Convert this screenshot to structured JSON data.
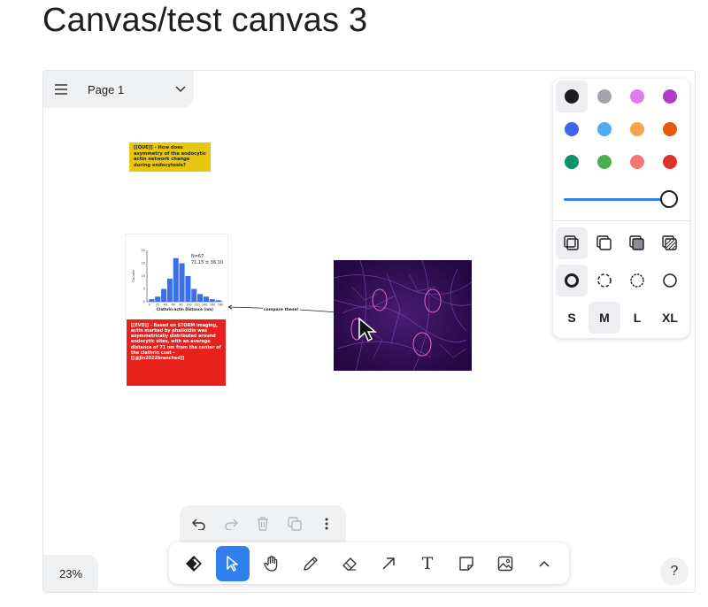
{
  "page_title": "Canvas/test canvas 3",
  "page_menu": {
    "name": "Page 1"
  },
  "notes": {
    "question": "[[QUE]] - How does asymmetry of the endocytic actin network change during endocytosis?",
    "evidence": "[[EVD]] - Based on STORM imaging, actin marked by phalloidin was asymmetrically distributed around endocytic sites, with an average distance of 71 nm from the center of the clathrin coat - [[@Jin2022branched]]"
  },
  "histogram": {
    "annotation_n": "N=67",
    "annotation_mean": "71.15 ± 36.10",
    "xlabel": "Clathrin-actin Distance (nm)",
    "ylabel": "Counts",
    "x_ticks": [
      "0",
      "25",
      "40",
      "60",
      "80",
      "100",
      "120",
      "140",
      "160",
      "180"
    ],
    "y_ticks": [
      "0",
      "5",
      "10",
      "15",
      "20"
    ],
    "ylim": [
      0,
      20
    ],
    "values": [
      1,
      2,
      5,
      9,
      17,
      15,
      10,
      5,
      3,
      2,
      1,
      0.6
    ],
    "bar_color": "#3a6fe8"
  },
  "arrow_label": "compare these!",
  "style_panel": {
    "colors": [
      "#1d1d1d",
      "#a1a4ab",
      "#e07de8",
      "#ae3ec9",
      "#4263eb",
      "#4dabf7",
      "#f5a54a",
      "#e8590c",
      "#099268",
      "#4caf50",
      "#f47676",
      "#e03131"
    ],
    "selected_color_index": 0,
    "opacity": 1.0,
    "sizes": [
      "S",
      "M",
      "L",
      "XL"
    ],
    "selected_size": "M"
  },
  "action_bar": {
    "icons": [
      "undo-icon",
      "redo-icon",
      "delete-icon",
      "duplicate-icon",
      "more-icon"
    ]
  },
  "toolbar": {
    "tools": [
      "draw-logo-icon",
      "select-icon",
      "hand-icon",
      "pencil-icon",
      "eraser-icon",
      "arrow-icon",
      "text-icon",
      "note-icon",
      "image-icon",
      "chevron-up-icon"
    ],
    "active_tool": "select",
    "text_tool_glyph": "T"
  },
  "zoom": "23%",
  "help": "?"
}
